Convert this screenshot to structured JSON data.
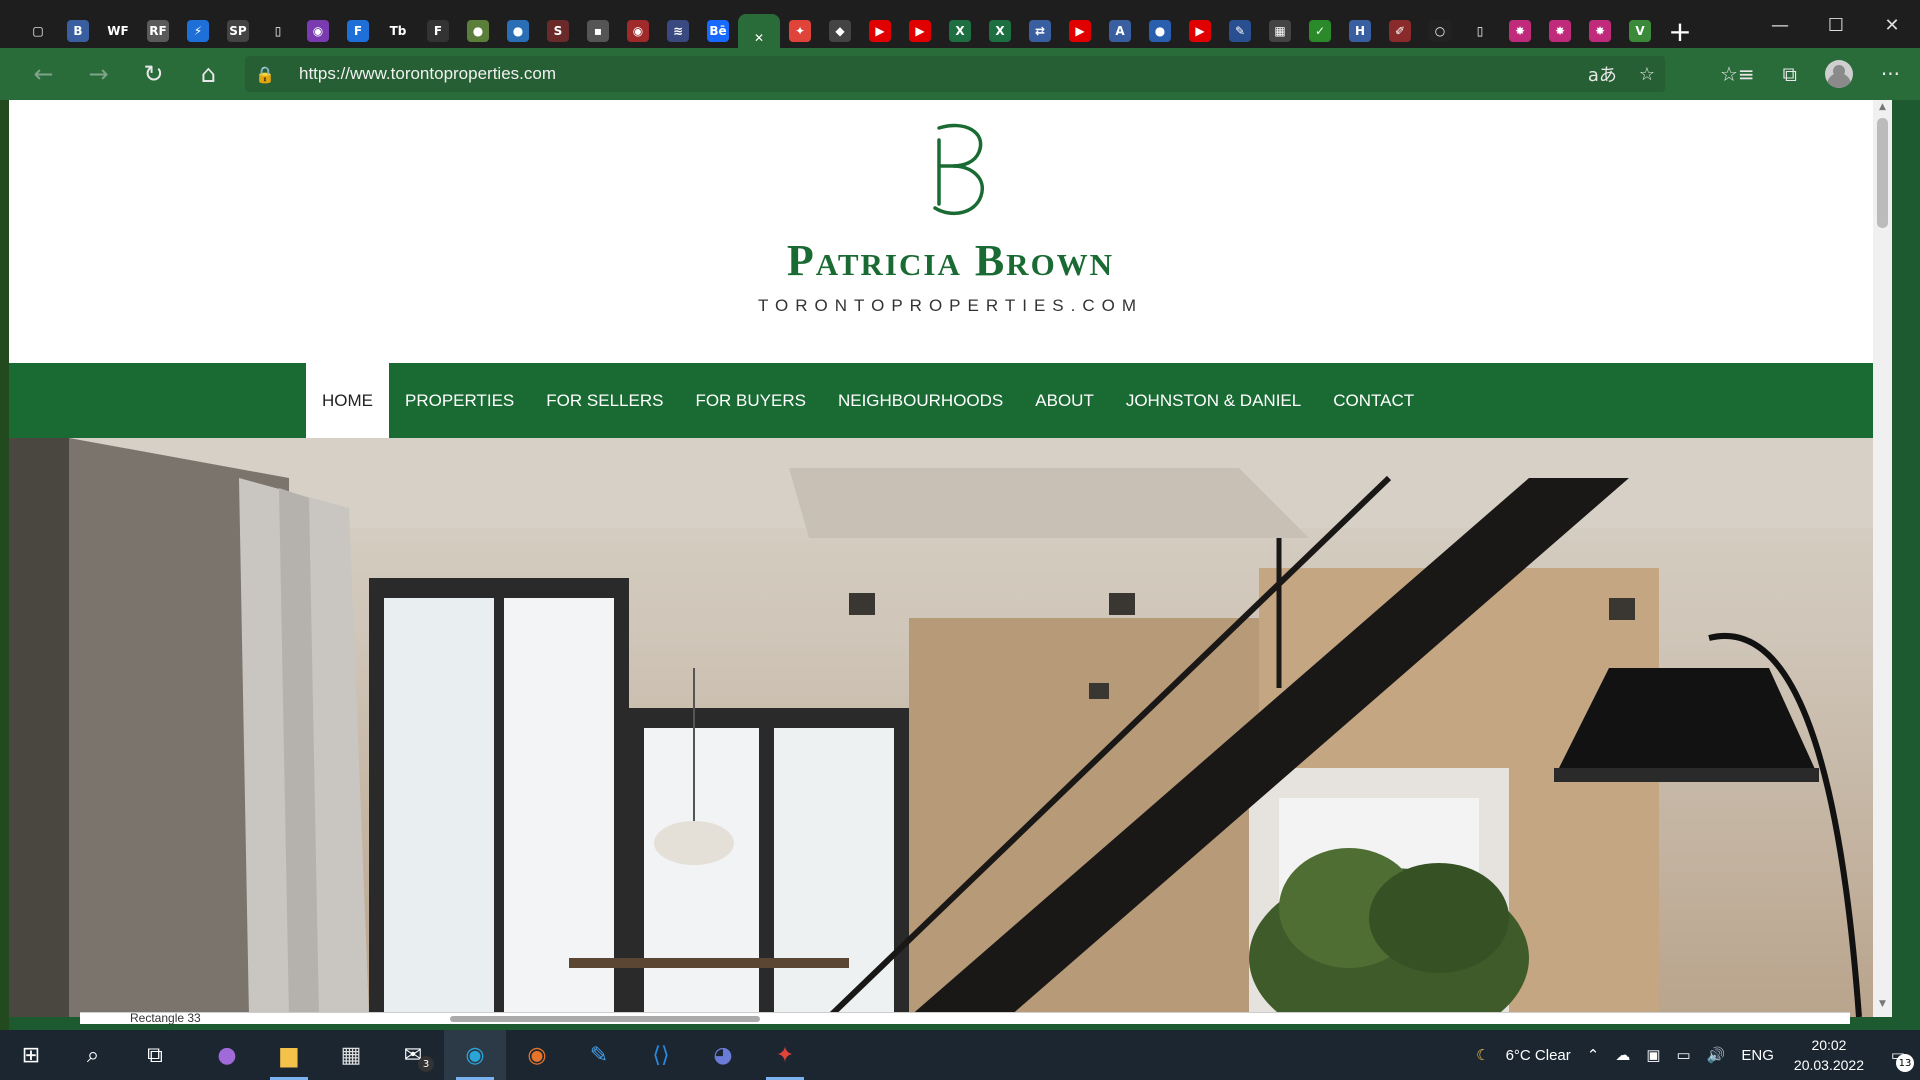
{
  "browser": {
    "tabs": [
      {
        "icon": "tab-actions-icon",
        "glyph": "▢",
        "color": "#1e1e1e"
      },
      {
        "icon": "site-favicon-ts",
        "glyph": "ꓐ",
        "color": "#3a5fa0"
      },
      {
        "icon": "site-favicon-wf",
        "glyph": "WF",
        "color": "#1e1e1e"
      },
      {
        "icon": "site-favicon-rf",
        "glyph": "RF",
        "color": "#5a5a5a"
      },
      {
        "icon": "site-favicon-bolt",
        "glyph": "⚡",
        "color": "#1e6fd8"
      },
      {
        "icon": "site-favicon-sp",
        "glyph": "SP",
        "color": "#444"
      },
      {
        "icon": "page-icon",
        "glyph": "▯",
        "color": "#1e1e1e"
      },
      {
        "icon": "color-wheel-icon",
        "glyph": "◉",
        "color": "#7a3bb0"
      },
      {
        "icon": "site-favicon-f",
        "glyph": "F",
        "color": "#1e6fd8"
      },
      {
        "icon": "site-favicon-tb",
        "glyph": "Tb",
        "color": "#1e1e1e"
      },
      {
        "icon": "site-favicon-faded-f",
        "glyph": "F",
        "color": "#333"
      },
      {
        "icon": "globe-icon",
        "glyph": "●",
        "color": "#5b7f3a"
      },
      {
        "icon": "circle-icon",
        "glyph": "●",
        "color": "#2a6fb5"
      },
      {
        "icon": "site-favicon-s",
        "glyph": "S",
        "color": "#6a2a2a"
      },
      {
        "icon": "chat-icon",
        "glyph": "▪",
        "color": "#555"
      },
      {
        "icon": "record-icon",
        "glyph": "◉",
        "color": "#a02a2a"
      },
      {
        "icon": "stripes-icon",
        "glyph": "≋",
        "color": "#3a4a80"
      },
      {
        "icon": "behance-icon",
        "glyph": "Bē",
        "color": "#1769ff"
      },
      {
        "icon": "close-tab-icon",
        "glyph": "✕",
        "color": "#2a6b3a"
      },
      {
        "icon": "figma-icon",
        "glyph": "✦",
        "color": "#e0433a"
      },
      {
        "icon": "layers-icon",
        "glyph": "◆",
        "color": "#444"
      },
      {
        "icon": "youtube-icon",
        "glyph": "▶",
        "color": "#e00000"
      },
      {
        "icon": "youtube-icon",
        "glyph": "▶",
        "color": "#e00000"
      },
      {
        "icon": "excel-icon",
        "glyph": "X",
        "color": "#1d6f42"
      },
      {
        "icon": "excel-icon",
        "glyph": "X",
        "color": "#1d6f42"
      },
      {
        "icon": "translate-icon",
        "glyph": "⇄",
        "color": "#3a5fa0"
      },
      {
        "icon": "youtube-icon",
        "glyph": "▶",
        "color": "#e00000"
      },
      {
        "icon": "site-favicon-a",
        "glyph": "A",
        "color": "#3a5fa0"
      },
      {
        "icon": "shield-icon",
        "glyph": "●",
        "color": "#2a5fb0"
      },
      {
        "icon": "youtube-icon",
        "glyph": "▶",
        "color": "#e00000"
      },
      {
        "icon": "feather-icon",
        "glyph": "✎",
        "color": "#2a4f90"
      },
      {
        "icon": "keyboard-icon",
        "glyph": "▦",
        "color": "#444"
      },
      {
        "icon": "check-icon",
        "glyph": "✓",
        "color": "#2a8a2a"
      },
      {
        "icon": "site-favicon-h",
        "glyph": "H",
        "color": "#3a5fa0"
      },
      {
        "icon": "pen-icon",
        "glyph": "✐",
        "color": "#8a2a2a"
      },
      {
        "icon": "ring-icon",
        "glyph": "○",
        "color": "#222"
      },
      {
        "icon": "page-icon",
        "glyph": "▯",
        "color": "#1e1e1e"
      },
      {
        "icon": "star-puzzle-icon",
        "glyph": "✸",
        "color": "#c02a7a"
      },
      {
        "icon": "star-puzzle-icon",
        "glyph": "✸",
        "color": "#c02a7a"
      },
      {
        "icon": "star-puzzle-icon",
        "glyph": "✸",
        "color": "#c02a7a"
      },
      {
        "icon": "vuetify-icon",
        "glyph": "V",
        "color": "#3a8a3a"
      }
    ],
    "new_tab": "+",
    "window": {
      "minimize": "—",
      "maximize": "☐",
      "close": "✕"
    },
    "url": "https://www.torontoproperties.com",
    "toolbar": {
      "back": "←",
      "forward": "→",
      "refresh": "↻",
      "home": "⌂",
      "lock": "🔒",
      "read_aloud": "aあ",
      "favorite_add": "☆",
      "favorites": "☆≡",
      "collections": "⧉",
      "more": "···"
    }
  },
  "site": {
    "brand": "Patricia Brown",
    "subtitle": "TORONTOPROPERTIES.COM",
    "accent": "#1a6b33",
    "nav": [
      {
        "label": "HOME",
        "active": true
      },
      {
        "label": "PROPERTIES"
      },
      {
        "label": "FOR SELLERS"
      },
      {
        "label": "FOR BUYERS"
      },
      {
        "label": "NEIGHBOURHOODS"
      },
      {
        "label": "ABOUT"
      },
      {
        "label": "JOHNSTON & DANIEL"
      },
      {
        "label": "CONTACT"
      }
    ]
  },
  "overlay": {
    "label": "Rectangle 33"
  },
  "taskbar": {
    "items": [
      {
        "icon": "windows-start-icon",
        "glyph": "⊞"
      },
      {
        "icon": "search-icon",
        "glyph": "⌕"
      },
      {
        "icon": "task-view-icon",
        "glyph": "⧉"
      },
      {
        "icon": "app-purple-icon",
        "glyph": "●",
        "color": "#a06bd8"
      },
      {
        "icon": "file-explorer-icon",
        "glyph": "▆",
        "color": "#f2c24a",
        "running": true
      },
      {
        "icon": "store-icon",
        "glyph": "▦",
        "color": "#ddd"
      },
      {
        "icon": "mail-icon",
        "glyph": "✉",
        "badge": "3"
      },
      {
        "icon": "edge-icon",
        "glyph": "◉",
        "color": "#2aa5d8",
        "running": true,
        "active": true
      },
      {
        "icon": "firefox-icon",
        "glyph": "◉",
        "color": "#e8742a"
      },
      {
        "icon": "pen-tablet-icon",
        "glyph": "✎",
        "color": "#4aa0e8"
      },
      {
        "icon": "vscode-icon",
        "glyph": "⟨⟩",
        "color": "#2a8ae0"
      },
      {
        "icon": "discord-icon",
        "glyph": "◕",
        "color": "#6a7bd8"
      },
      {
        "icon": "figma-icon",
        "glyph": "✦",
        "color": "#e0433a",
        "running": true
      }
    ],
    "weather": "6°C  Clear",
    "weather_icon": "☾",
    "tray_icons": [
      "⌃",
      "☁",
      "▣",
      "▭",
      "🔊"
    ],
    "language": "ENG",
    "time": "20:02",
    "date": "20.03.2022",
    "notifications": "13"
  }
}
